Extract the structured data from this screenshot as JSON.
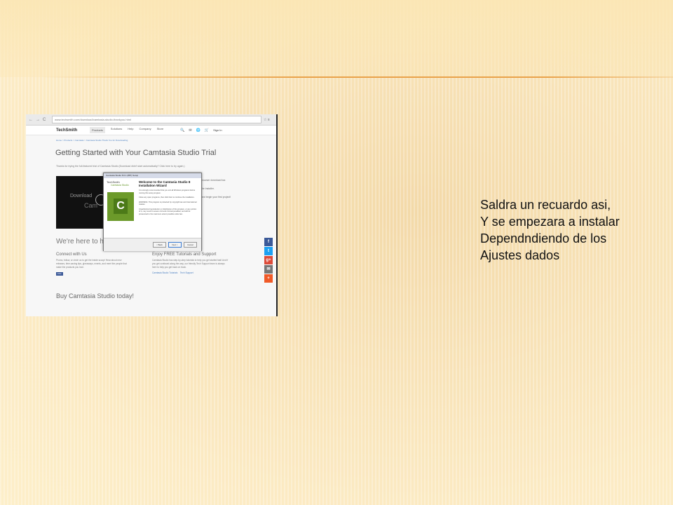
{
  "caption": {
    "lines": [
      "Saldra un recuardo asi,",
      "Y se empezara a instalar",
      "Dependndiendo de los",
      "Ajustes dados"
    ]
  },
  "browser": {
    "nav": [
      "←",
      "→",
      "C"
    ],
    "url": "www.techsmith.com/download/camtasia-studio-thankyou.html",
    "tools": "☆ ≡"
  },
  "site": {
    "logo": "TechSmith",
    "menu": [
      "Products",
      "Solutions",
      "Help",
      "Company",
      "Store"
    ],
    "icons": [
      "🔍",
      "✉",
      "🌐",
      "🛒"
    ],
    "sign_in": "Sign In",
    "breadcrumb": "Home > Products > Camtasia > Camtasia Studio Thank You for Downloading",
    "heading": "Getting Started with Your Camtasia Studio Trial",
    "thanks": "Thanks for trying the full-featured trial of Camtasia Studio (Download didn't start automatically? Click here to try again.)",
    "video_text1": "Download",
    "video_text2": "Cam",
    "right_notes": [
      "browser download bar.",
      "the installer.",
      "and begin your first project!"
    ],
    "heres_to": "We're here to h",
    "connect": {
      "heading": "Connect with Us",
      "body": "Promo, follow, or circle us to get the inside scoop! Hear about new releases, time-saving tips, giveaways, events, and meet the people that make the products you love.",
      "like": "Like"
    },
    "tutorials": {
      "heading": "Enjoy FREE Tutorials and Support",
      "body": "Camtasia Studio has step-by-step tutorials to help you get started fast! And if you get confused along the way, our friendly Tech Support team is always here to help you get back on track.",
      "link1": "Camtasia Studio Tutorials",
      "link2": "Tech Support"
    },
    "buy": "Buy Camtasia Studio today!",
    "share": [
      {
        "icon": "facebook-icon",
        "glyph": "f",
        "color": "#3b5998"
      },
      {
        "icon": "twitter-icon",
        "glyph": "t",
        "color": "#1da1f2"
      },
      {
        "icon": "google-plus-icon",
        "glyph": "g+",
        "color": "#dd4b39"
      },
      {
        "icon": "email-icon",
        "glyph": "✉",
        "color": "#777777"
      },
      {
        "icon": "more-icon",
        "glyph": "+",
        "color": "#f05a28"
      }
    ]
  },
  "installer": {
    "title": "Camtasia Studio 8.0.1 (887) Setup",
    "brand": "TechSmith",
    "product": "Camtasia Studio",
    "heading": "Welcome to the Camtasia Studio 8 Installation Wizard",
    "p1": "It is strongly recommended that you exit all Windows programs before running this setup program.",
    "p2": "Close any open programs, then click Next to continue the installation.",
    "p3": "WARNING: This program is protected by copyright law and international treaties.",
    "p4": "Unauthorized reproduction or distribution of this program, or any portion of it, may result in severe civil and criminal penalties, and will be prosecuted to the maximum extent possible under law.",
    "back": "< Back",
    "next": "Next >",
    "cancel": "Cancel",
    "logo_glyph": "C"
  }
}
